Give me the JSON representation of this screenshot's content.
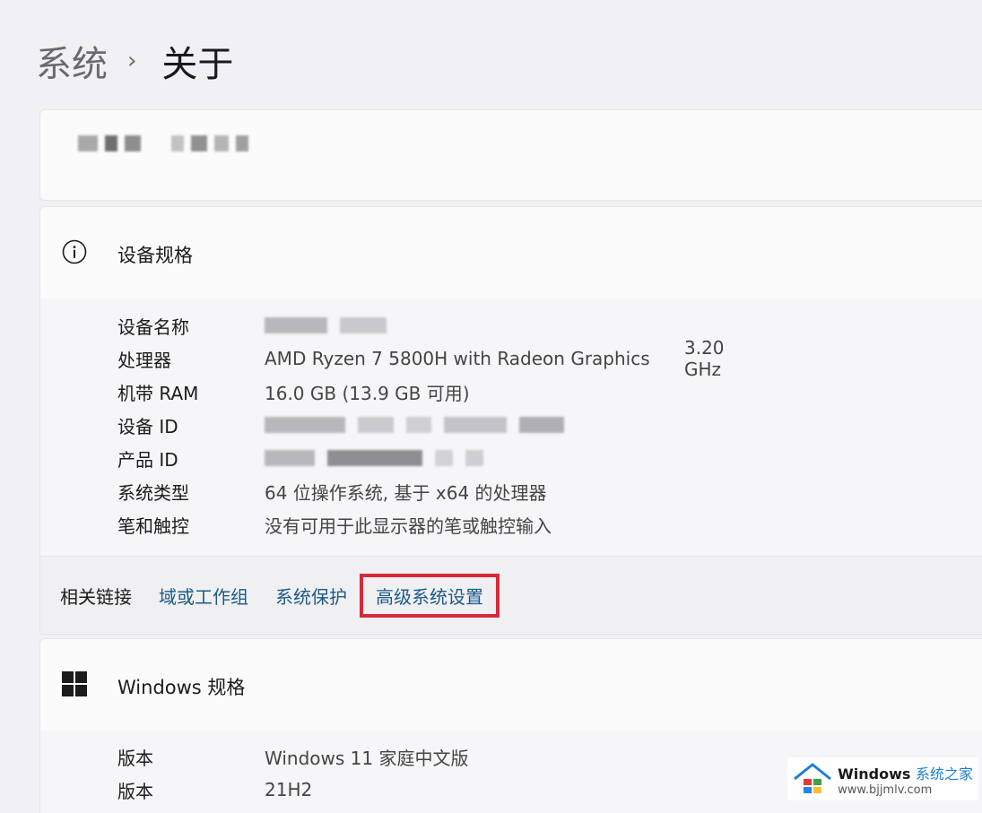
{
  "breadcrumb": {
    "parent": "系统",
    "separator": "›",
    "current": "关于"
  },
  "device_card": {
    "name_redacted": true
  },
  "specs": {
    "title": "设备规格",
    "icon": "info-icon",
    "rows": [
      {
        "label": "设备名称",
        "value": "",
        "redacted": true
      },
      {
        "label": "处理器",
        "value": "AMD Ryzen 7 5800H with Radeon Graphics",
        "extra": "3.20 GHz"
      },
      {
        "label": "机带 RAM",
        "value": "16.0 GB (13.9 GB 可用)"
      },
      {
        "label": "设备 ID",
        "value": "",
        "redacted": true
      },
      {
        "label": "产品 ID",
        "value": "",
        "redacted": true
      },
      {
        "label": "系统类型",
        "value": "64 位操作系统, 基于 x64 的处理器"
      },
      {
        "label": "笔和触控",
        "value": "没有可用于此显示器的笔或触控输入"
      }
    ]
  },
  "related": {
    "label": "相关链接",
    "links": [
      "域或工作组",
      "系统保护",
      "高级系统设置"
    ],
    "highlight_color": "#d52a3a"
  },
  "windows": {
    "title": "Windows 规格",
    "icon": "windows-logo-icon",
    "rows": [
      {
        "label": "版本",
        "value": "Windows 11 家庭中文版"
      },
      {
        "label": "版本",
        "value": "21H2"
      }
    ]
  },
  "watermark": {
    "brand": "Windows",
    "brand_suffix": "系统之家",
    "url": "www.bjjmlv.com"
  },
  "colors": {
    "link": "#1a5a8a",
    "background": "#f1f1f5",
    "card": "#fbfbfc"
  }
}
